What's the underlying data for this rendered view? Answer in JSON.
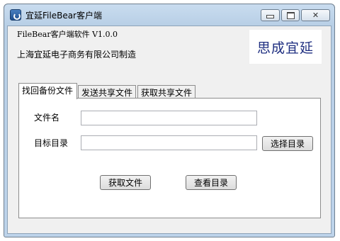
{
  "window": {
    "title": "宜延FileBear客户端"
  },
  "header": {
    "version": "FileBear客户端软件 V1.0.0",
    "company": "上海宜延电子商务有限公司制造",
    "logo_text": "思成宜延"
  },
  "tabs": [
    {
      "label": "找回备份文件"
    },
    {
      "label": "发送共享文件"
    },
    {
      "label": "获取共享文件"
    }
  ],
  "form": {
    "file_name_label": "文件名",
    "file_name_value": "",
    "target_dir_label": "目标目录",
    "target_dir_value": "",
    "choose_dir_button": "选择目录",
    "get_file_button": "获取文件",
    "view_dir_button": "查看目录"
  }
}
